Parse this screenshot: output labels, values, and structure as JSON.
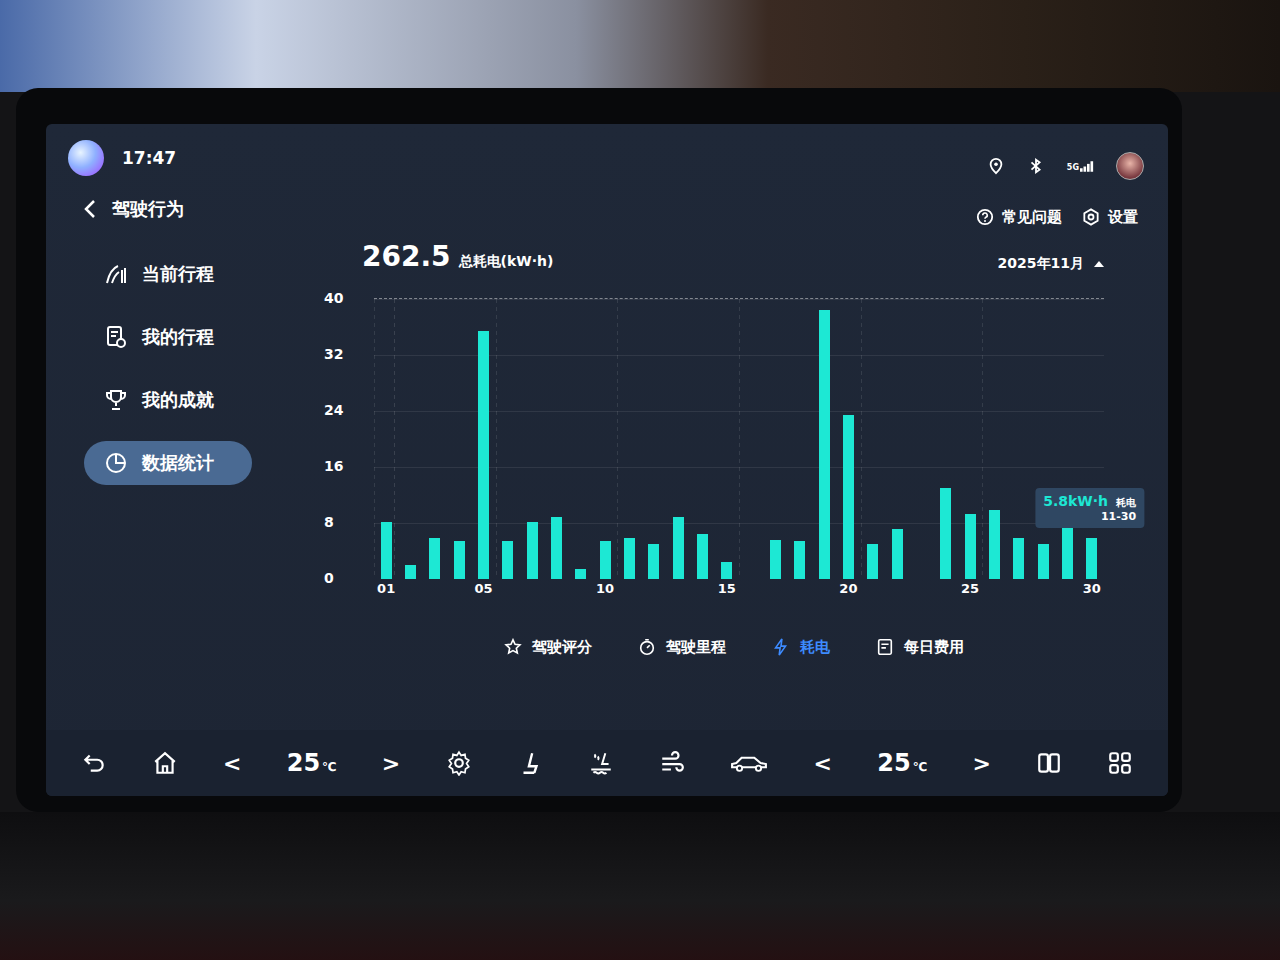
{
  "status_bar": {
    "time": "17:47",
    "signal": "5G"
  },
  "header": {
    "title": "驾驶行为",
    "links": [
      "常见问题",
      "设置"
    ]
  },
  "sidebar": {
    "items": [
      {
        "label": "当前行程",
        "selected": false
      },
      {
        "label": "我的行程",
        "selected": false
      },
      {
        "label": "我的成就",
        "selected": false
      },
      {
        "label": "数据统计",
        "selected": true
      }
    ]
  },
  "summary": {
    "total": "262.5",
    "label": "总耗电(kW·h)",
    "month": "2025年11月"
  },
  "chart": {
    "y_ticks": [
      "40",
      "32",
      "24",
      "16",
      "8",
      "0"
    ],
    "x_ticks": [
      "01",
      "05",
      "10",
      "15",
      "20",
      "25",
      "30"
    ],
    "values": [
      8.1,
      2,
      5.8,
      5.5,
      35.5,
      5.4,
      8.2,
      8.8,
      1.5,
      5.5,
      5.8,
      5,
      8.8,
      6.5,
      2.5,
      0,
      5.6,
      5.5,
      38.5,
      23.5,
      5,
      7.2,
      0,
      13,
      9.3,
      9.8,
      5.8,
      5,
      7.5,
      5.8
    ],
    "tooltip": {
      "value": "5.8kW·h",
      "label": "耗电",
      "date": "11-30"
    }
  },
  "tabs": [
    {
      "label": "驾驶评分",
      "selected": false
    },
    {
      "label": "驾驶里程",
      "selected": false
    },
    {
      "label": "耗电",
      "selected": true
    },
    {
      "label": "每日费用",
      "selected": false
    }
  ],
  "dock": {
    "left_temp": {
      "prev": "<",
      "value": "25",
      "unit": "℃",
      "next": ">"
    },
    "right_temp": {
      "prev": "<",
      "value": "25",
      "unit": "℃",
      "next": ">"
    }
  }
}
